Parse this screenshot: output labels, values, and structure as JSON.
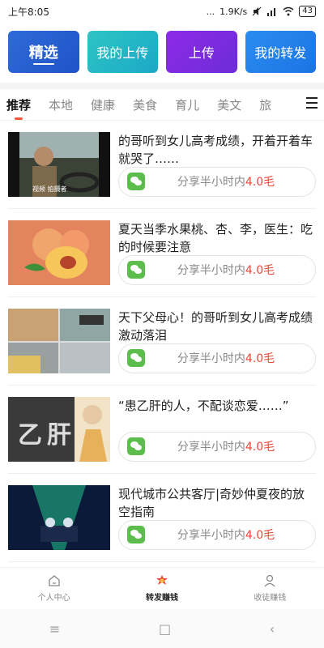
{
  "status_bar": {
    "time": "上午8:05",
    "signal_dots": "...",
    "speed": "1.9K/s",
    "battery": "43"
  },
  "top_buttons": [
    {
      "label": "精选"
    },
    {
      "label": "我的上传"
    },
    {
      "label": "上传"
    },
    {
      "label": "我的转发"
    }
  ],
  "tabs": [
    {
      "label": "推荐"
    },
    {
      "label": "本地"
    },
    {
      "label": "健康"
    },
    {
      "label": "美食"
    },
    {
      "label": "育儿"
    },
    {
      "label": "美文"
    },
    {
      "label": "旅"
    }
  ],
  "feed": [
    {
      "title": "的哥听到女儿高考成绩，开着开着车就哭了……",
      "share_text": "分享半小时内",
      "share_amount": "4.0毛",
      "thumb_caption": "视频  拍摄者  "
    },
    {
      "title": "夏天当季水果桃、杏、李，医生：吃的时候要注意",
      "share_text": "分享半小时内",
      "share_amount": "4.0毛"
    },
    {
      "title": "天下父母心！的哥听到女儿高考成绩激动落泪",
      "share_text": "分享半小时内",
      "share_amount": "4.0毛"
    },
    {
      "title": "“患乙肝的人，不配谈恋爱……”",
      "share_text": "分享半小时内",
      "share_amount": "4.0毛",
      "thumb_caption": "乙肝"
    },
    {
      "title": "现代城市公共客厅|奇妙仲夏夜的放空指南",
      "share_text": "分享半小时内",
      "share_amount": "4.0毛"
    }
  ],
  "bottom_nav": [
    {
      "label": "个人中心"
    },
    {
      "label": "转发赚钱"
    },
    {
      "label": "收徒赚钱"
    }
  ],
  "system_nav": {
    "menu": "≡",
    "home": "□",
    "back": "‹"
  },
  "colors": {
    "accent_red": "#e8483a",
    "wechat_green": "#5dbd4c"
  }
}
